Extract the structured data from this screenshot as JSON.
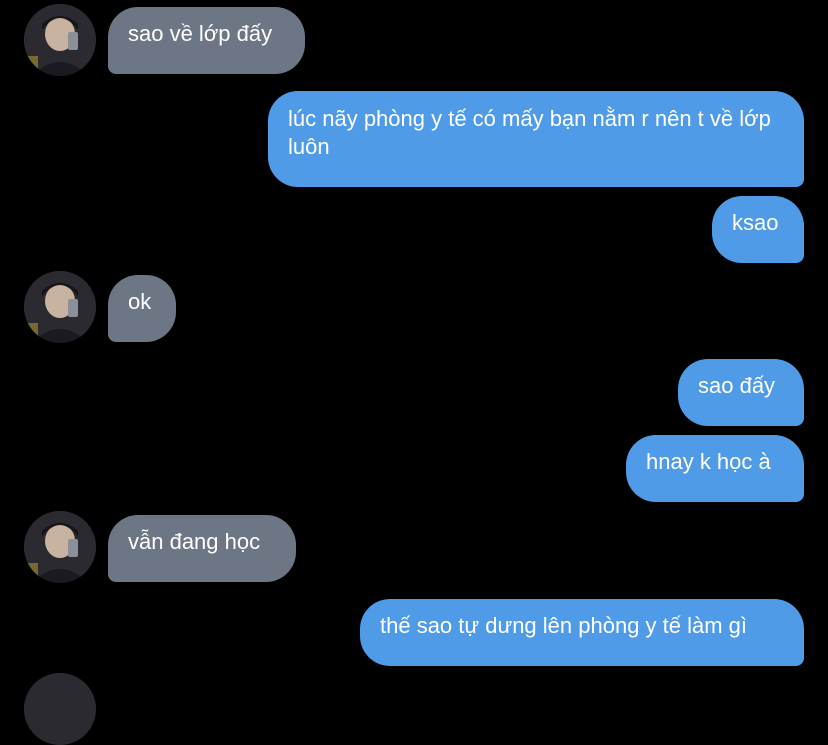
{
  "conversation": {
    "messages": [
      {
        "from": "them",
        "text": "sao về lớp đấy"
      },
      {
        "from": "me",
        "text": "lúc nãy phòng y tế có mấy bạn nằm r nên t về lớp luôn"
      },
      {
        "from": "me",
        "text": "ksao"
      },
      {
        "from": "them",
        "text": "ok"
      },
      {
        "from": "me",
        "text": "sao đấy"
      },
      {
        "from": "me",
        "text": "hnay k học à"
      },
      {
        "from": "them",
        "text": "vẫn đang học"
      },
      {
        "from": "me",
        "text": "thế sao tự dưng lên phòng y tế làm gì"
      }
    ]
  },
  "colors": {
    "background": "#000000",
    "incoming_bubble": "#6d7684",
    "outgoing_bubble": "#4f9be8",
    "text": "#ffffff"
  },
  "icons": {
    "avatar": "user-avatar-photo"
  }
}
